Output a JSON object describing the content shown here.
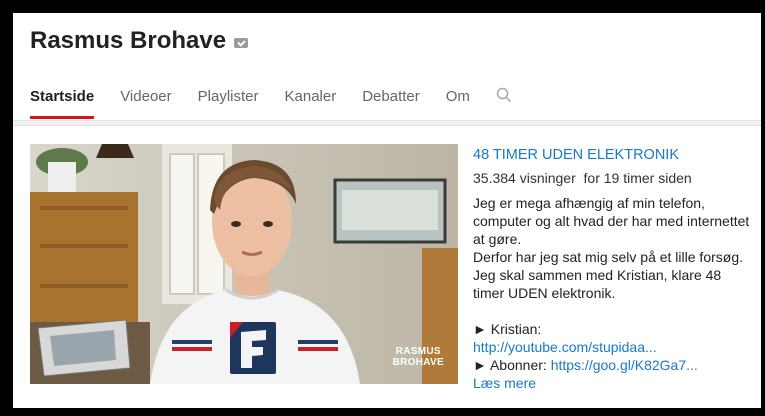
{
  "channel": {
    "name": "Rasmus Brohave",
    "verified_icon": "verified-badge-icon"
  },
  "tabs": [
    {
      "label": "Startside",
      "active": true
    },
    {
      "label": "Videoer"
    },
    {
      "label": "Playlister"
    },
    {
      "label": "Kanaler"
    },
    {
      "label": "Debatter"
    },
    {
      "label": "Om"
    }
  ],
  "search": {
    "icon": "search-icon"
  },
  "featured": {
    "thumbnail_watermark_line1": "RASMUS",
    "thumbnail_watermark_line2": "BROHAVE",
    "title": "48 TIMER UDEN ELEKTRONIK",
    "views": "35.384 visninger",
    "age": "for 19 timer siden",
    "description_1": "Jeg er mega afhængig af min telefon, computer og alt hvad der har med internettet at gøre.",
    "description_2": "Derfor har jeg sat mig selv på et lille forsøg. Jeg skal sammen med Kristian, klare 48 timer UDEN elektronik.",
    "link1_label": "► Kristian:",
    "link1_url": "http://youtube.com/stupidaa...",
    "link2_label": "► Abonner:",
    "link2_url": "https://goo.gl/K82Ga7...",
    "read_more": "Læs mere"
  },
  "colors": {
    "accent_red": "#cc181e",
    "link_blue": "#167ac6"
  }
}
